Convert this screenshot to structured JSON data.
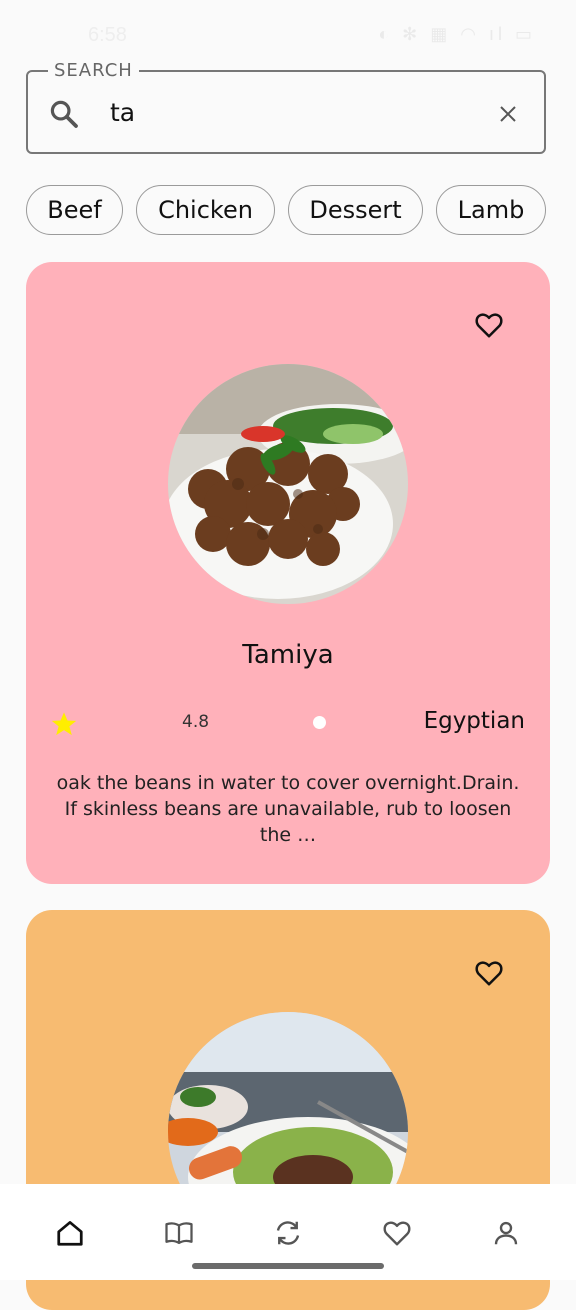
{
  "status_bar": {
    "time": "6:58",
    "icons": "◐ ✻ ▦ ◠ ıl ▭"
  },
  "search": {
    "label": "SEARCH",
    "value": "ta",
    "icon": "search-icon",
    "clear_icon": "close-icon"
  },
  "categories": [
    "Beef",
    "Chicken",
    "Dessert",
    "Lamb"
  ],
  "meals": [
    {
      "name": "Tamiya",
      "rating": "4.8",
      "area": "Egyptian",
      "description": "oak the beans in water to cover overnight.Drain. If skinless beans are unavailable, rub to loosen the …",
      "background": "#ffb1ba"
    },
    {
      "name": "",
      "background": "#f7bb71"
    }
  ],
  "bottom_nav": {
    "items": [
      "home-icon",
      "book-icon",
      "refresh-icon",
      "heart-icon",
      "profile-icon"
    ]
  },
  "colors": {
    "star": "#ffee00",
    "card_pink": "#ffb1ba",
    "card_orange": "#f7bb71"
  }
}
